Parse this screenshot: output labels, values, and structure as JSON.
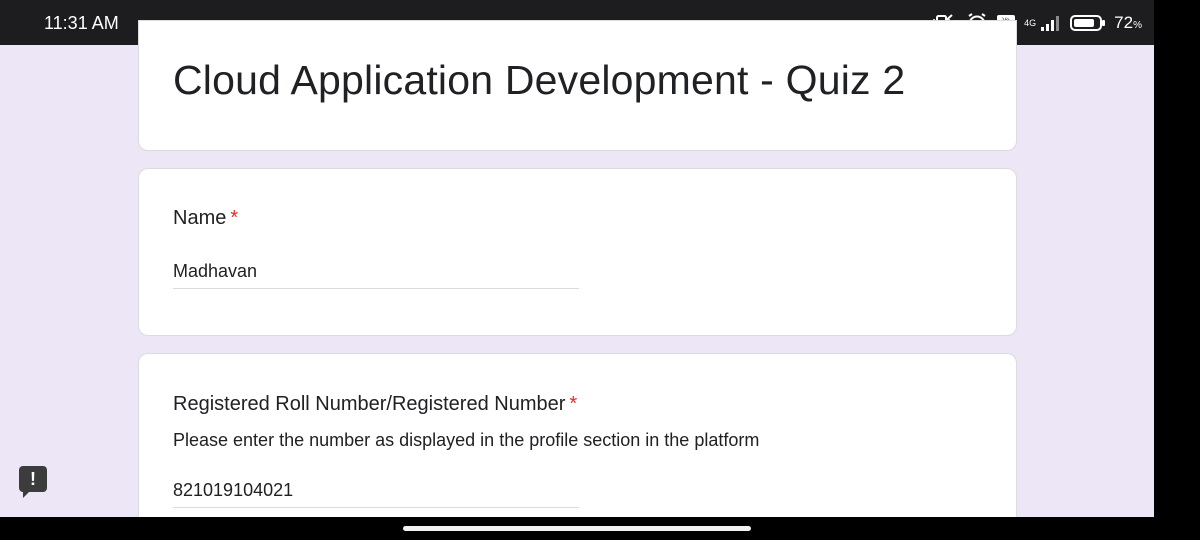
{
  "status_bar": {
    "time": "11:31 AM",
    "network": "4G",
    "battery_percent": "72",
    "battery_unit": "%",
    "icons": [
      "mute-vibrate-icon",
      "alarm-icon",
      "volte-icon",
      "signal-icon",
      "battery-icon"
    ]
  },
  "form": {
    "title": "Cloud Application Development - Quiz 2",
    "questions": [
      {
        "label": "Name",
        "required_mark": "*",
        "value": "Madhavan"
      },
      {
        "label": "Registered Roll Number/Registered Number",
        "required_mark": "*",
        "description": "Please enter the number as displayed in the profile section in the platform",
        "value": "821019104021"
      }
    ]
  },
  "overlay": {
    "alert_badge": "!"
  },
  "colors": {
    "background": "#ece6f6",
    "required": "#d93025",
    "card": "#ffffff"
  }
}
